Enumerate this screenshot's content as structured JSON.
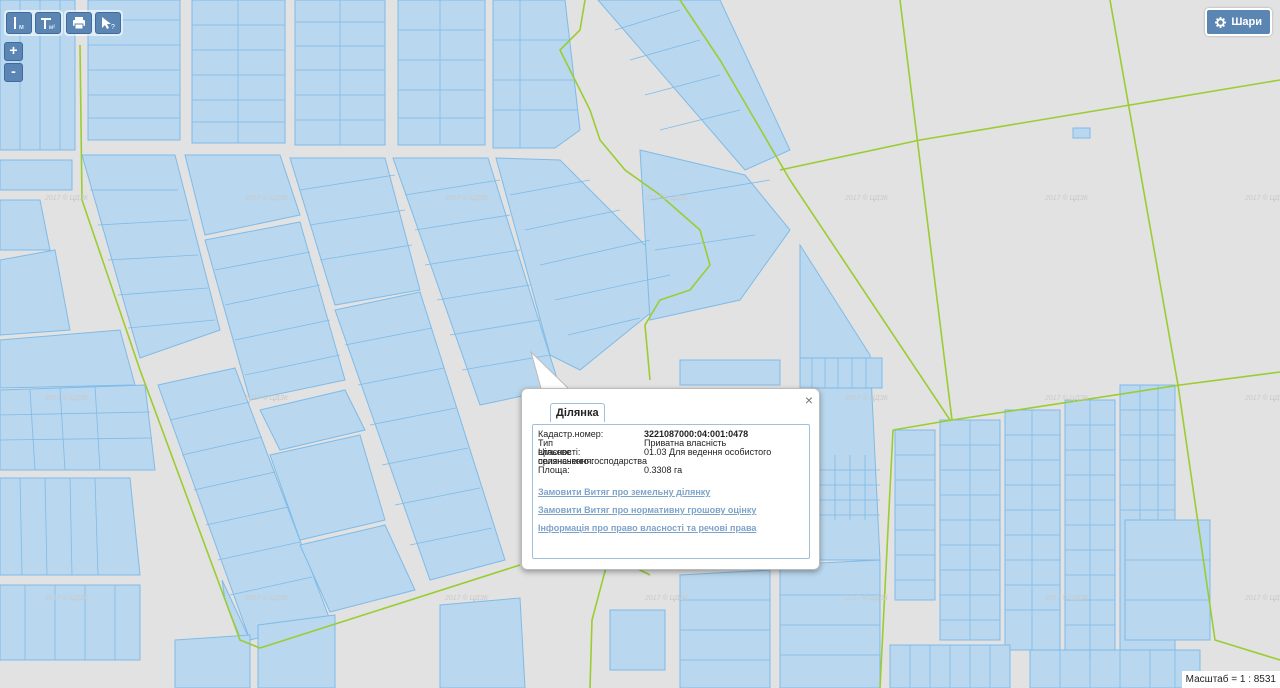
{
  "toolbar": {
    "buttons": [
      {
        "name": "measure-length-button",
        "label": "м"
      },
      {
        "name": "measure-area-button",
        "label": "м²"
      },
      {
        "name": "print-button",
        "label": "print-icon"
      },
      {
        "name": "identify-button",
        "label": "cursor-help-icon"
      }
    ]
  },
  "zoom": {
    "in_label": "+",
    "out_label": "-"
  },
  "layers": {
    "label": "Шари",
    "icon": "gear-icon"
  },
  "popup": {
    "tab_label": "Ділянка",
    "close_label": "×",
    "fields": [
      {
        "label": "Кадастр.номер:",
        "value": "3221087000:04:001:0478"
      },
      {
        "label": "Тип власності:",
        "value": "Приватна власність"
      },
      {
        "label": "Цільове призначення:",
        "value": "01.03 Для ведення особистого"
      },
      {
        "label": "селянського господарства",
        "value": ""
      },
      {
        "label": "Площа:",
        "value": "0.3308 га"
      }
    ],
    "links": [
      "Замовити Витяг про земельну ділянку",
      "Замовити Витяг про нормативну грошову оцінку",
      "Інформація про право власності та речові права"
    ]
  },
  "watermark": "2017 © ЦДЗК",
  "scale": {
    "label": "Масштаб = 1 : 8531"
  },
  "colors": {
    "background": "#e2e2e2",
    "parcel_fill": "#b9d7ee",
    "parcel_stroke": "#7fbbe8",
    "boundary": "#9acd32",
    "button": "#5b86b4"
  }
}
